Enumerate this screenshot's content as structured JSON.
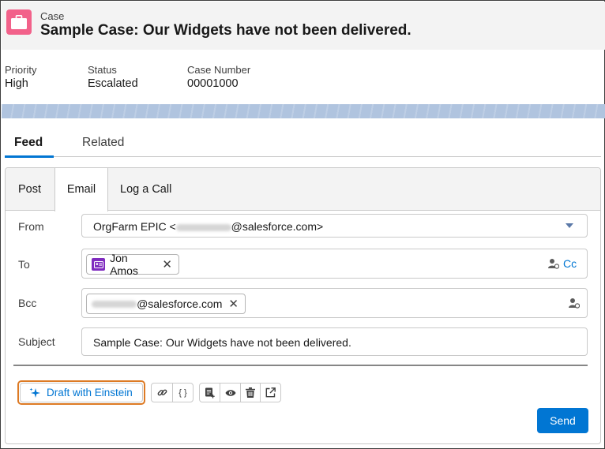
{
  "header": {
    "object_label": "Case",
    "title": "Sample Case: Our Widgets have not been delivered."
  },
  "highlights": [
    {
      "label": "Priority",
      "value": "High"
    },
    {
      "label": "Status",
      "value": "Escalated"
    },
    {
      "label": "Case Number",
      "value": "00001000"
    }
  ],
  "main_tabs": [
    {
      "label": "Feed",
      "active": true
    },
    {
      "label": "Related",
      "active": false
    }
  ],
  "publisher": {
    "tabs": [
      {
        "label": "Post",
        "active": false
      },
      {
        "label": "Email",
        "active": true
      },
      {
        "label": "Log a Call",
        "active": false
      }
    ],
    "from": {
      "label": "From",
      "value_prefix": "OrgFarm EPIC <",
      "value_suffix": "@salesforce.com>"
    },
    "to": {
      "label": "To",
      "recipient": "Jon Amos",
      "cc_label": "Cc"
    },
    "bcc": {
      "label": "Bcc",
      "recipient_suffix": "@salesforce.com"
    },
    "subject": {
      "label": "Subject",
      "value": "Sample Case: Our Widgets have not been delivered."
    },
    "einstein_button": "Draft with Einstein",
    "send_button": "Send"
  },
  "icons": [
    "briefcase-icon",
    "contact-card-icon",
    "close-icon",
    "person-add-icon",
    "chevron-down-icon",
    "sparkle-icon",
    "link-icon",
    "merge-field-icon",
    "template-icon",
    "preview-icon",
    "delete-icon",
    "pop-out-icon"
  ],
  "colors": {
    "accent": "#0176d3",
    "case_icon": "#f2618a",
    "contact_icon": "#7f2bbf",
    "highlight_outline": "#dd7a24"
  }
}
